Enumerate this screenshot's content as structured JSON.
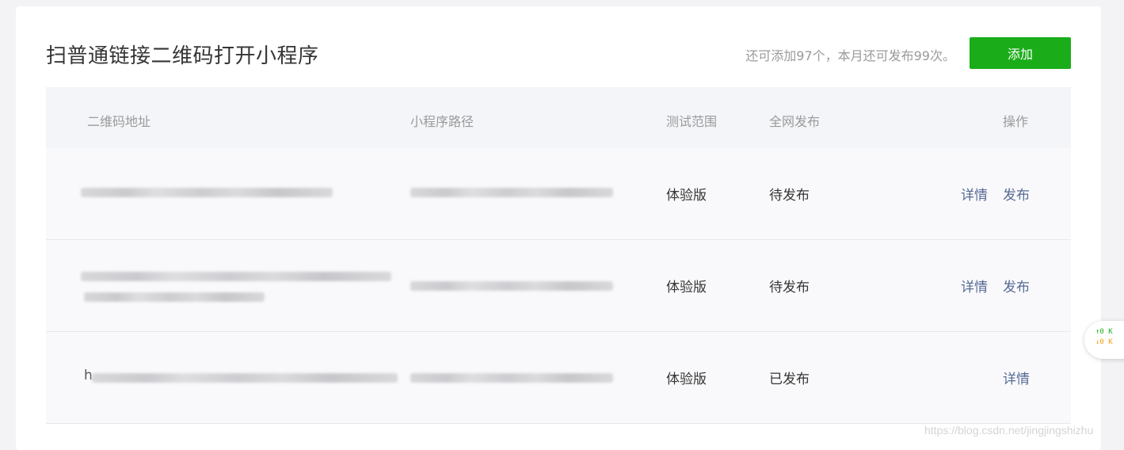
{
  "header": {
    "title": "扫普通链接二维码打开小程序",
    "quota_text": "还可添加97个，本月还可发布99次。",
    "add_label": "添加"
  },
  "table": {
    "columns": [
      "二维码地址",
      "小程序路径",
      "测试范围",
      "全网发布",
      "操作"
    ],
    "rows": [
      {
        "range": "体验版",
        "status": "待发布",
        "detail": "详情",
        "publish": "发布"
      },
      {
        "range": "体验版",
        "status": "待发布",
        "detail": "详情",
        "publish": "发布"
      },
      {
        "range": "体验版",
        "status": "已发布",
        "detail": "详情",
        "publish": ""
      }
    ],
    "row3_prefix": "h"
  },
  "widget": {
    "up": "↑0  K",
    "down": "↓0  K"
  },
  "watermark": "https://blog.csdn.net/jingjingshizhu",
  "colors": {
    "accent": "#1aad19",
    "link": "#576b95"
  }
}
